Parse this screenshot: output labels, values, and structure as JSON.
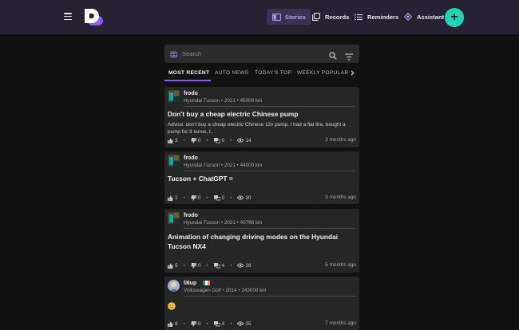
{
  "nav": {
    "stories": "Stories",
    "records": "Records",
    "reminders": "Reminders",
    "assistant": "Assistant",
    "fab": "+"
  },
  "search": {
    "placeholder": "Search"
  },
  "tabs": [
    "MOST RECENT",
    "AUTO NEWS",
    "TODAY'S TOP",
    "WEEKLY POPULAR"
  ],
  "posts": [
    {
      "author": "frodo",
      "meta": "Hyundai Tucson • 2021 • 45000 km",
      "title": "Don't buy a cheap electric Chinese pump",
      "excerpt": "Advice: don't buy a cheap electric Chinese 12v pump. I had a flat tire, bought a pump for 9 euros, t...",
      "likes": "3",
      "dislikes": "0",
      "comments": "0",
      "views": "14",
      "time": "2 months ago"
    },
    {
      "author": "frodo",
      "meta": "Hyundai Tucson • 2021 • 44000 km",
      "title": "Tucson + ChatGPT =",
      "likes": "1",
      "dislikes": "0",
      "comments": "0",
      "views": "20",
      "time": "3 months ago"
    },
    {
      "author": "frodo",
      "meta": "Hyundai Tucson • 2021 • 40766 km",
      "title": "Animation of changing driving modes on the Hyundai Tucson NX4",
      "likes": "5",
      "dislikes": "0",
      "comments": "4",
      "views": "28",
      "time": "5 months ago"
    },
    {
      "author": "li6up",
      "meta": "Volkswagen Golf • 2014 • 243000 km",
      "likes": "8",
      "dislikes": "0",
      "comments": "4",
      "views": "35",
      "time": "7 months ago"
    }
  ],
  "colors": {
    "topbar": "#262232",
    "accent": "#8e62e8",
    "fab": "#1ed6b4",
    "card": "#262626",
    "background": "#111111"
  }
}
